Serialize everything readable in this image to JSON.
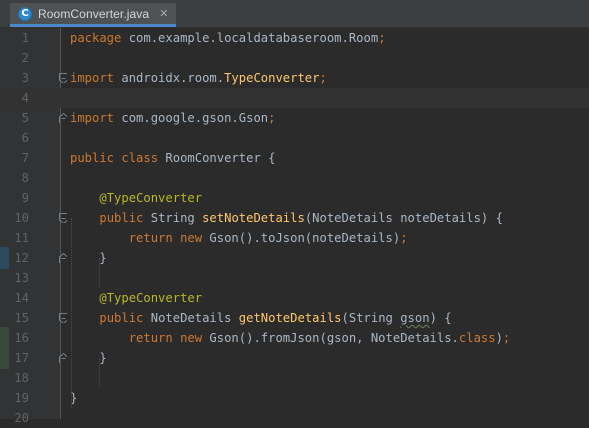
{
  "tab": {
    "label": "RoomConverter.java",
    "icon": "C",
    "close_icon": "✕"
  },
  "lines": [
    {
      "n": "1",
      "tokens": [
        {
          "t": "package",
          "c": "kw"
        },
        {
          "t": " com.example.localdatabaseroom.Room",
          "c": ""
        },
        {
          "t": ";",
          "c": "kw"
        }
      ]
    },
    {
      "n": "2",
      "tokens": []
    },
    {
      "n": "3",
      "tokens": [
        {
          "t": "import",
          "c": "kw"
        },
        {
          "t": " androidx.room.",
          "c": ""
        },
        {
          "t": "TypeConverter",
          "c": "fn"
        },
        {
          "t": ";",
          "c": "kw"
        }
      ]
    },
    {
      "n": "4",
      "tokens": []
    },
    {
      "n": "5",
      "tokens": [
        {
          "t": "import",
          "c": "kw"
        },
        {
          "t": " com.google.gson.Gson",
          "c": ""
        },
        {
          "t": ";",
          "c": "kw"
        }
      ]
    },
    {
      "n": "6",
      "tokens": []
    },
    {
      "n": "7",
      "tokens": [
        {
          "t": "public class",
          "c": "kw"
        },
        {
          "t": " RoomConverter {",
          "c": ""
        }
      ]
    },
    {
      "n": "8",
      "tokens": []
    },
    {
      "n": "9",
      "tokens": [
        {
          "t": "    ",
          "c": ""
        },
        {
          "t": "@TypeConverter",
          "c": "ann"
        }
      ]
    },
    {
      "n": "10",
      "tokens": [
        {
          "t": "    ",
          "c": ""
        },
        {
          "t": "public",
          "c": "kw"
        },
        {
          "t": " String ",
          "c": ""
        },
        {
          "t": "setNoteDetails",
          "c": "fn"
        },
        {
          "t": "(NoteDetails noteDetails) {",
          "c": ""
        }
      ]
    },
    {
      "n": "11",
      "tokens": [
        {
          "t": "        ",
          "c": ""
        },
        {
          "t": "return new",
          "c": "kw"
        },
        {
          "t": " Gson().toJson(noteDetails)",
          "c": ""
        },
        {
          "t": ";",
          "c": "kw"
        }
      ]
    },
    {
      "n": "12",
      "tokens": [
        {
          "t": "    }",
          "c": ""
        }
      ]
    },
    {
      "n": "13",
      "tokens": []
    },
    {
      "n": "14",
      "tokens": [
        {
          "t": "    ",
          "c": ""
        },
        {
          "t": "@TypeConverter",
          "c": "ann"
        }
      ]
    },
    {
      "n": "15",
      "tokens": [
        {
          "t": "    ",
          "c": ""
        },
        {
          "t": "public",
          "c": "kw"
        },
        {
          "t": " NoteDetails ",
          "c": ""
        },
        {
          "t": "getNoteDetails",
          "c": "fn"
        },
        {
          "t": "(String ",
          "c": ""
        },
        {
          "t": "gson",
          "c": "wavy"
        },
        {
          "t": ") {",
          "c": ""
        }
      ]
    },
    {
      "n": "16",
      "tokens": [
        {
          "t": "        ",
          "c": ""
        },
        {
          "t": "return new",
          "c": "kw"
        },
        {
          "t": " Gson().fromJson(gson, NoteDetails.",
          "c": ""
        },
        {
          "t": "class",
          "c": "kw"
        },
        {
          "t": ")",
          "c": ""
        },
        {
          "t": ";",
          "c": "kw"
        }
      ]
    },
    {
      "n": "17",
      "tokens": [
        {
          "t": "    }",
          "c": ""
        }
      ]
    },
    {
      "n": "18",
      "tokens": []
    },
    {
      "n": "19",
      "tokens": [
        {
          "t": "}",
          "c": ""
        }
      ]
    },
    {
      "n": "20",
      "tokens": []
    }
  ],
  "colors": {
    "keyword": "#cc7832",
    "annotation": "#bbb529",
    "method": "#ffc66d",
    "text": "#a9b7c6",
    "background": "#2b2b2b"
  }
}
